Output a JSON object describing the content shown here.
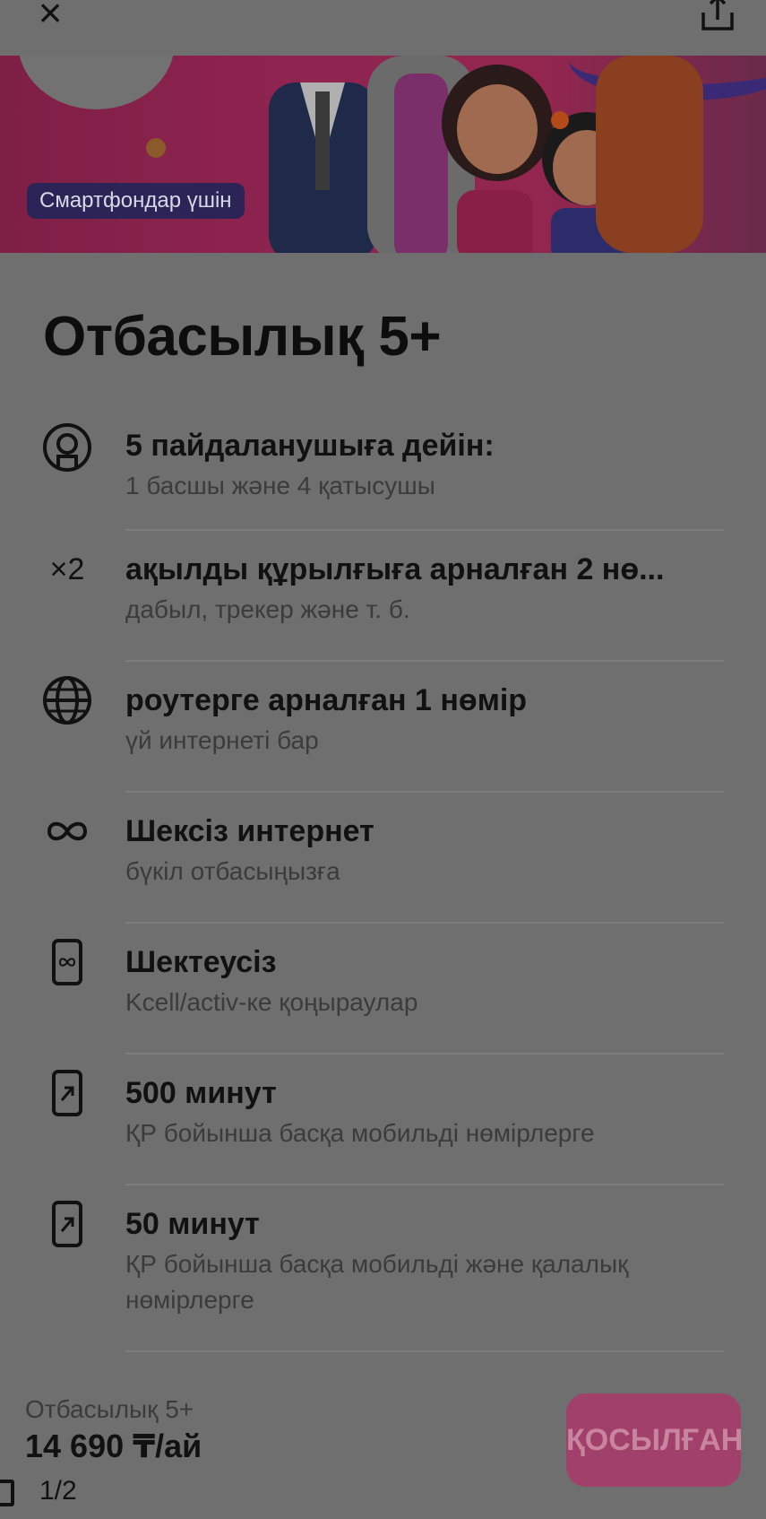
{
  "header": {
    "close_icon": "close-icon",
    "share_icon": "share-icon"
  },
  "hero": {
    "badge": "Смартфондар үшін"
  },
  "plan": {
    "title": "Отбасылық 5+"
  },
  "features": [
    {
      "icon": "user-circle-icon",
      "title": "5 пайдаланушыға дейін:",
      "subtitle": "1 басшы және 4 қатысушы"
    },
    {
      "icon": "x2-multiplier",
      "icon_text": "×2",
      "title": "ақылды құрылғыға арналған 2 нө...",
      "subtitle": "дабыл, трекер және т. б."
    },
    {
      "icon": "globe-icon",
      "title": "роутерге арналған 1 нөмір",
      "subtitle": "үй интернеті бар"
    },
    {
      "icon": "infinity-icon",
      "title": "Шексіз интернет",
      "subtitle": "бүкіл отбасыңызға"
    },
    {
      "icon": "phone-infinity-icon",
      "title": "Шектеусіз",
      "subtitle": "Kcell/activ-ке қоңыраулар"
    },
    {
      "icon": "phone-outgoing-icon",
      "title": "500 минут",
      "subtitle": "ҚР бойынша басқа мобильді нөмірлерге"
    },
    {
      "icon": "phone-outgoing-icon",
      "title": "50 минут",
      "subtitle": "ҚР бойынша басқа мобильді және қалалық нөмірлерге"
    }
  ],
  "footer": {
    "plan_name": "Отбасылық 5+",
    "price": "14 690 ₸/ай",
    "connect_label": "ҚОСЫЛҒАН"
  },
  "pager": {
    "text": "1/2"
  }
}
